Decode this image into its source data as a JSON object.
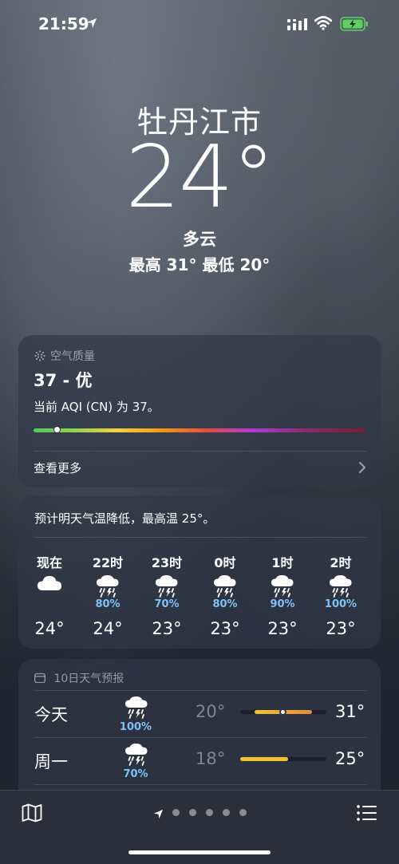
{
  "status_bar": {
    "time": "21:59"
  },
  "hero": {
    "city": "牡丹江市",
    "temperature": "24°",
    "condition": "多云",
    "high_low": "最高 31°  最低 20°"
  },
  "air_quality": {
    "title": "空气质量",
    "value": "37 - 优",
    "description": "当前 AQI (CN) 为 37。",
    "index_fraction": 0.07,
    "more_label": "查看更多"
  },
  "hourly": {
    "summary": "预计明天气温降低，最高温 25°。",
    "items": [
      {
        "time": "现在",
        "icon": "cloud-icon",
        "pop": "",
        "temp": "24°"
      },
      {
        "time": "22时",
        "icon": "thunderstorm-rain-icon",
        "pop": "80%",
        "temp": "24°"
      },
      {
        "time": "23时",
        "icon": "thunderstorm-rain-icon",
        "pop": "70%",
        "temp": "23°"
      },
      {
        "time": "0时",
        "icon": "thunderstorm-rain-icon",
        "pop": "80%",
        "temp": "23°"
      },
      {
        "time": "1时",
        "icon": "thunderstorm-rain-icon",
        "pop": "90%",
        "temp": "23°"
      },
      {
        "time": "2时",
        "icon": "thunderstorm-rain-icon",
        "pop": "100%",
        "temp": "23°"
      }
    ]
  },
  "daily": {
    "title": "10日天气预报",
    "items": [
      {
        "day": "今天",
        "icon": "thunderstorm-rain-icon",
        "pop": "100%",
        "low": "20°",
        "high": "31°"
      },
      {
        "day": "周一",
        "icon": "thunderstorm-rain-icon",
        "pop": "70%",
        "low": "18°",
        "high": "25°"
      }
    ]
  },
  "colors": {
    "precip": "#7dc4f5",
    "bar_cool": "#f1c232",
    "bar_warm": "#e98a3b"
  }
}
